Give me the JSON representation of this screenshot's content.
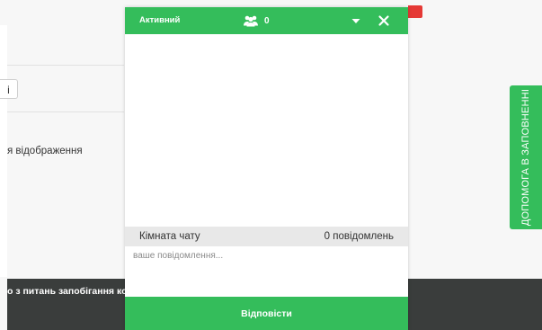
{
  "background_page": {
    "small_button_label": "і",
    "display_text": "я відображення",
    "footer_text": "о з питань запобігання ко"
  },
  "chat": {
    "status": "Активний",
    "users_count": "0",
    "room_name": "Кімната чату",
    "message_count": "0 повідомлень",
    "input_placeholder": "ваше повідомлення...",
    "reply_label": "Відповісти"
  },
  "help_tab": {
    "label": "ДОПОМОГА В ЗАПОВНЕННІ"
  },
  "icons": {
    "users": "users-icon",
    "minimize": "chevron-down-icon",
    "close": "close-icon"
  },
  "colors": {
    "accent_green": "#34bd5b",
    "footer_dark": "#3a3d3c",
    "badge_red": "#e53935",
    "room_bar": "#e8e8e8"
  }
}
